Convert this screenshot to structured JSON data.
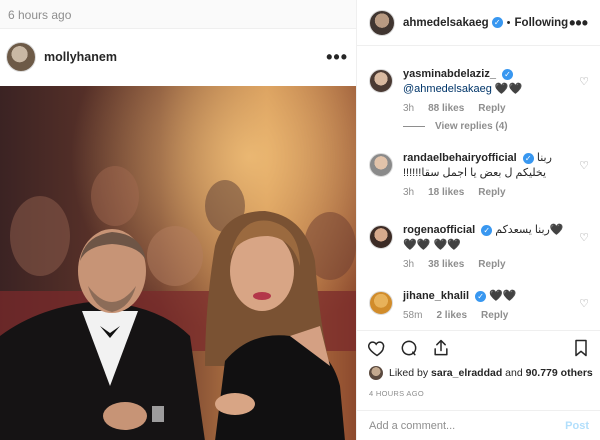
{
  "feed": {
    "time_ago": "6 hours ago"
  },
  "post": {
    "username": "mollyhanem",
    "more": "•••"
  },
  "panel": {
    "username": "ahmedelsakaeg",
    "verified_mark": "✓",
    "separator": "•",
    "follow_label": "Following",
    "more": "•••"
  },
  "comments": [
    {
      "username": "yasminabdelaziz_",
      "verified": true,
      "mention": "@ahmedelsakaeg",
      "text": "🖤🖤",
      "age": "3h",
      "likes": "88 likes",
      "reply": "Reply",
      "view_replies": "View replies (4)"
    },
    {
      "username": "randaelbehairyofficial",
      "verified": true,
      "text": "ربنا يخليكم ل بعض يا اجمل سقا!!!!!!",
      "age": "3h",
      "likes": "18 likes",
      "reply": "Reply"
    },
    {
      "username": "rogenaofficial",
      "verified": true,
      "text": "ربنا يسعدكم🖤🖤🖤 🖤🖤",
      "age": "3h",
      "likes": "38 likes",
      "reply": "Reply"
    },
    {
      "username": "jihane_khalil",
      "verified": true,
      "text": "🖤🖤",
      "age": "58m",
      "likes": "2 likes",
      "reply": "Reply"
    }
  ],
  "actions": {
    "like_icon": "heart-outline-icon",
    "comment_icon": "comment-bubble-icon",
    "share_icon": "share-icon",
    "save_icon": "bookmark-icon"
  },
  "likes_line": {
    "prefix": "Liked by ",
    "first_user": "sara_elraddad",
    "middle": " and ",
    "others": "90.779 others"
  },
  "timestamp": "4 HOURS AGO",
  "add_comment": {
    "placeholder": "Add a comment...",
    "post_label": "Post"
  },
  "colors": {
    "verified": "#3897f0",
    "link": "#003569",
    "post_disabled": "#b2dffc"
  }
}
